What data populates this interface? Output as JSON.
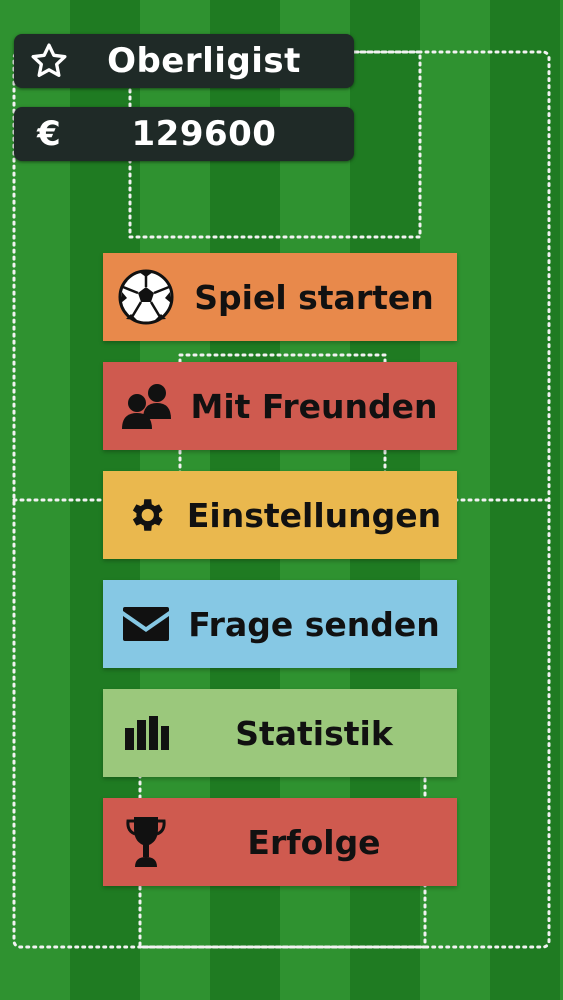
{
  "header": {
    "rank_icon": "star-outline-icon",
    "rank": "Oberligist",
    "money_symbol": "€",
    "money": "129600"
  },
  "menu": {
    "items": [
      {
        "label": "Spiel starten",
        "icon": "soccer-ball-icon",
        "color": "#e8894b"
      },
      {
        "label": "Mit Freunden",
        "icon": "people-icon",
        "color": "#cf5a4f"
      },
      {
        "label": "Einstellungen",
        "icon": "gear-icon",
        "color": "#eab84e"
      },
      {
        "label": "Frage senden",
        "icon": "envelope-icon",
        "color": "#86c8e4"
      },
      {
        "label": "Statistik",
        "icon": "bar-chart-icon",
        "color": "#9bc87c"
      },
      {
        "label": "Erfolge",
        "icon": "trophy-icon",
        "color": "#cf5a4f"
      }
    ]
  },
  "colors": {
    "field_light": "#2f9230",
    "field_dark": "#1f7b22",
    "pill_bg": "#1f2a27"
  }
}
